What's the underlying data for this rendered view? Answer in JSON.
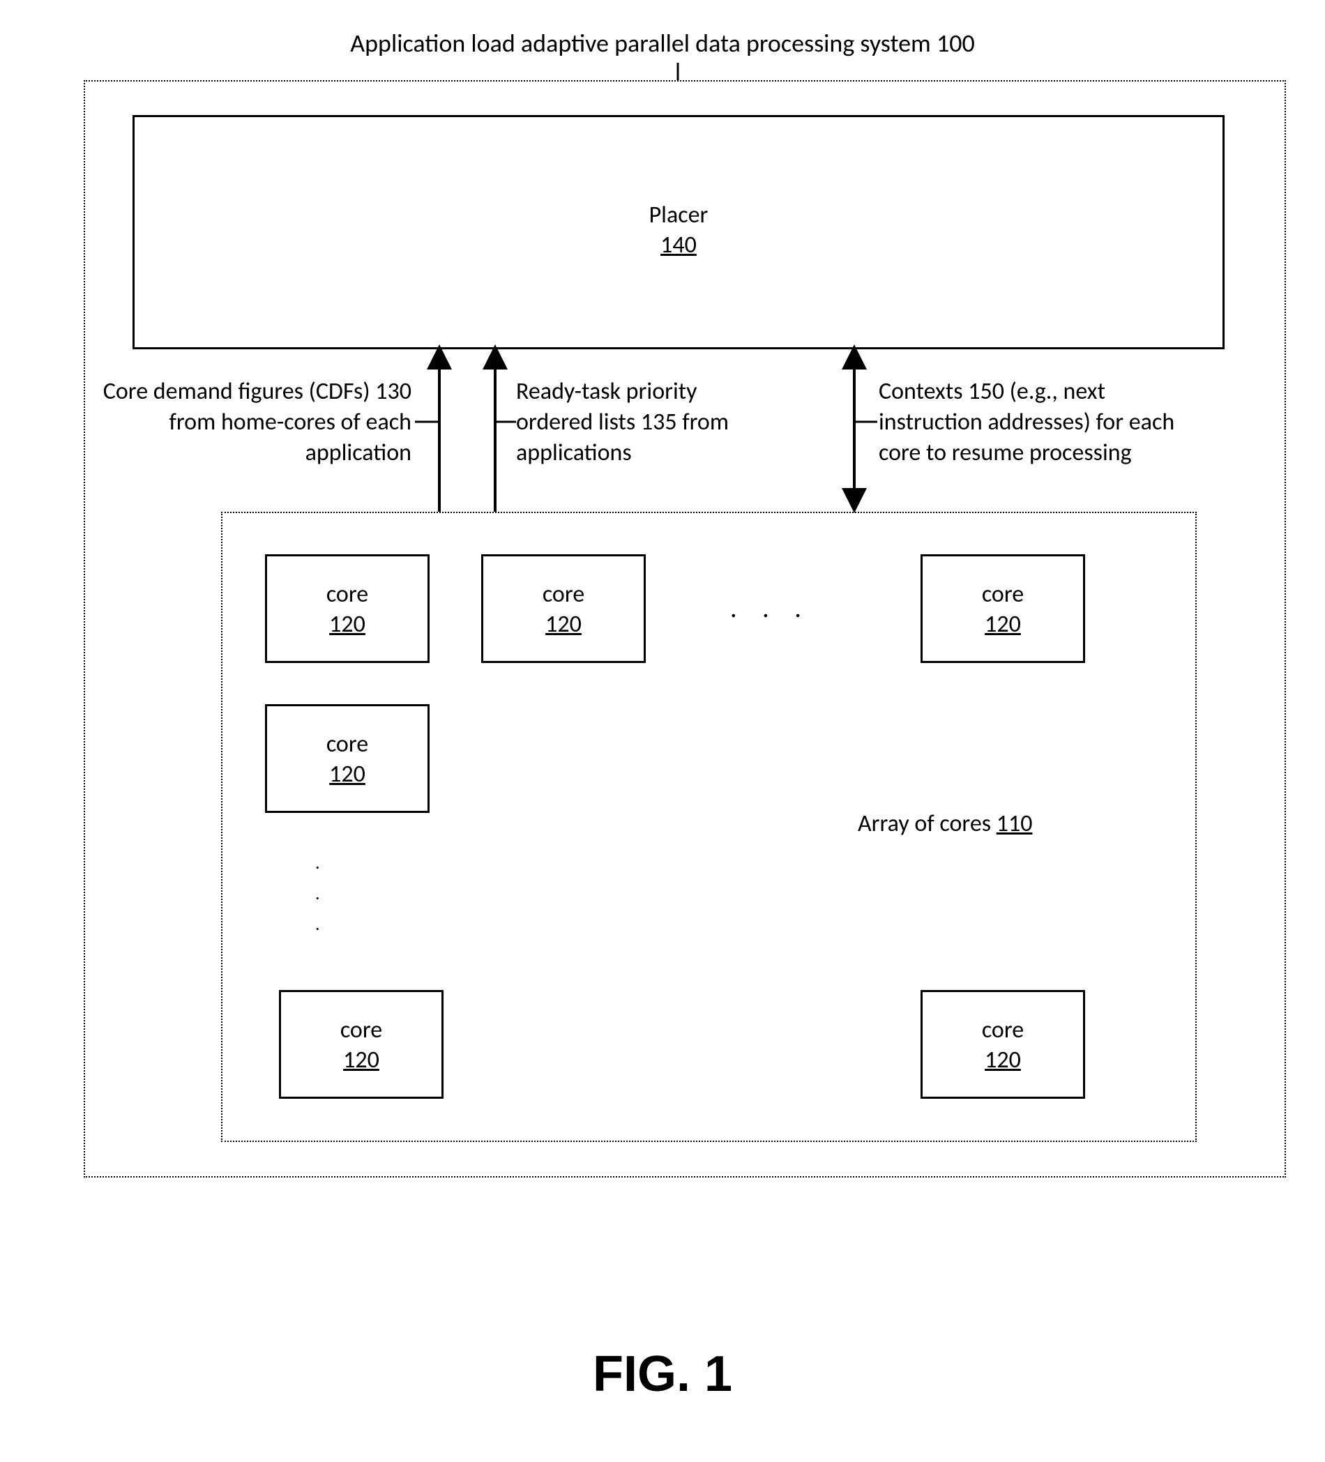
{
  "title_text": "Application load adaptive parallel data processing system 100",
  "placer": {
    "name": "Placer",
    "ref": "140"
  },
  "labels": {
    "cdf": "Core demand figures (CDFs) 130 from home-cores of each application",
    "ready": "Ready-task priority ordered lists 135 from applications",
    "contexts": "Contexts 150 (e.g., next instruction addresses) for each core to resume processing"
  },
  "array": {
    "name": "Array of cores ",
    "ref": "110"
  },
  "core": {
    "name": "core",
    "ref": "120"
  },
  "ellipsis_h": ". . .",
  "ellipsis_v1": ".",
  "ellipsis_v2": ".",
  "ellipsis_v3": ".",
  "figure": "FIG. 1"
}
